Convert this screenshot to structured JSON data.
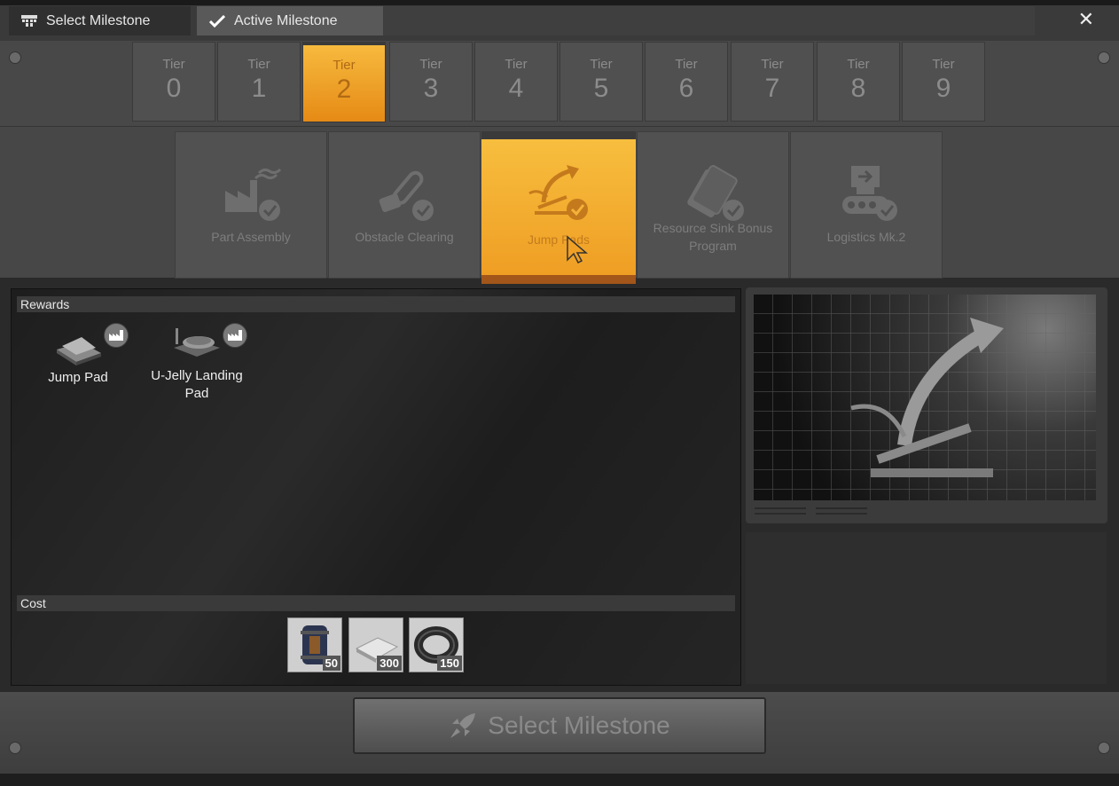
{
  "window": {
    "tabs": [
      {
        "label": "Select Milestone",
        "icon": "milestone-icon"
      },
      {
        "label": "Active Milestone",
        "icon": "checkmark-icon"
      }
    ],
    "close_glyph": "✕"
  },
  "tiers": [
    {
      "label": "Tier",
      "number": "0"
    },
    {
      "label": "Tier",
      "number": "1"
    },
    {
      "label": "Tier",
      "number": "2",
      "selected": true
    },
    {
      "label": "Tier",
      "number": "3"
    },
    {
      "label": "Tier",
      "number": "4"
    },
    {
      "label": "Tier",
      "number": "5"
    },
    {
      "label": "Tier",
      "number": "6"
    },
    {
      "label": "Tier",
      "number": "7"
    },
    {
      "label": "Tier",
      "number": "8"
    },
    {
      "label": "Tier",
      "number": "9"
    }
  ],
  "milestones": [
    {
      "label": "Part Assembly",
      "icon": "factory-icon",
      "completed": true
    },
    {
      "label": "Obstacle Clearing",
      "icon": "chainsaw-icon",
      "completed": true
    },
    {
      "label": "Jump Pads",
      "icon": "jump-pad-icon",
      "completed": true,
      "selected": true
    },
    {
      "label": "Resource Sink Bonus Program",
      "icon": "coupon-icon",
      "completed": true
    },
    {
      "label": "Logistics Mk.2",
      "icon": "conveyor-icon",
      "completed": true
    }
  ],
  "rewards": {
    "heading": "Rewards",
    "items": [
      {
        "name": "Jump Pad",
        "badge_icon": "factory-badge-icon"
      },
      {
        "name": "U-Jelly Landing Pad",
        "badge_icon": "factory-badge-icon"
      }
    ]
  },
  "cost": {
    "heading": "Cost",
    "items": [
      {
        "icon": "rotor-icon",
        "amount": "50"
      },
      {
        "icon": "iron-plate-icon",
        "amount": "300"
      },
      {
        "icon": "wire-icon",
        "amount": "150"
      }
    ]
  },
  "preview": {
    "icon": "jump-pad-preview-icon"
  },
  "footer": {
    "button_label": "Select Milestone",
    "button_icon": "rocket-icon"
  },
  "colors": {
    "accent": "#f4a62a",
    "panel": "#1e1e1e",
    "bg": "#474747"
  }
}
